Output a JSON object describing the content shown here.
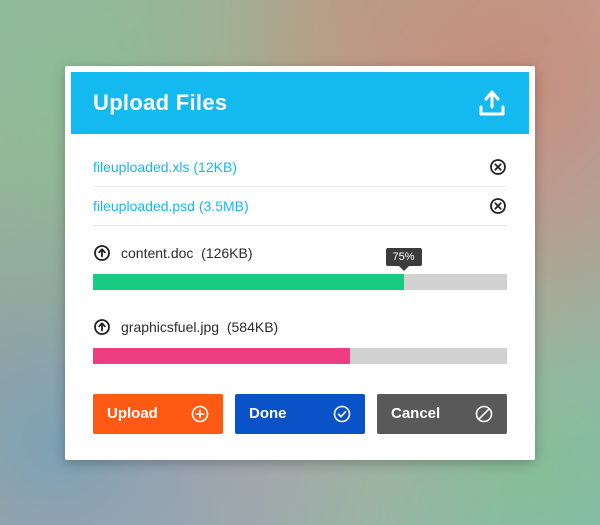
{
  "header": {
    "title": "Upload Files"
  },
  "completed": [
    {
      "name": "fileuploaded.xls",
      "size": "12KB"
    },
    {
      "name": "fileuploaded.psd",
      "size": "3.5MB"
    }
  ],
  "uploading": [
    {
      "name": "content.doc",
      "size": "126KB",
      "progress": 75,
      "color": "green",
      "show_tooltip": true,
      "tooltip": "75%"
    },
    {
      "name": "graphicsfuel.jpg",
      "size": "584KB",
      "progress": 62,
      "color": "pink",
      "show_tooltip": false
    }
  ],
  "buttons": {
    "upload": "Upload",
    "done": "Done",
    "cancel": "Cancel"
  },
  "colors": {
    "header": "#14b9ef",
    "progress_green": "#17cc82",
    "progress_pink": "#ef3d83",
    "btn_upload": "#ff5a14",
    "btn_done": "#0a52c7",
    "btn_cancel": "#595959"
  }
}
